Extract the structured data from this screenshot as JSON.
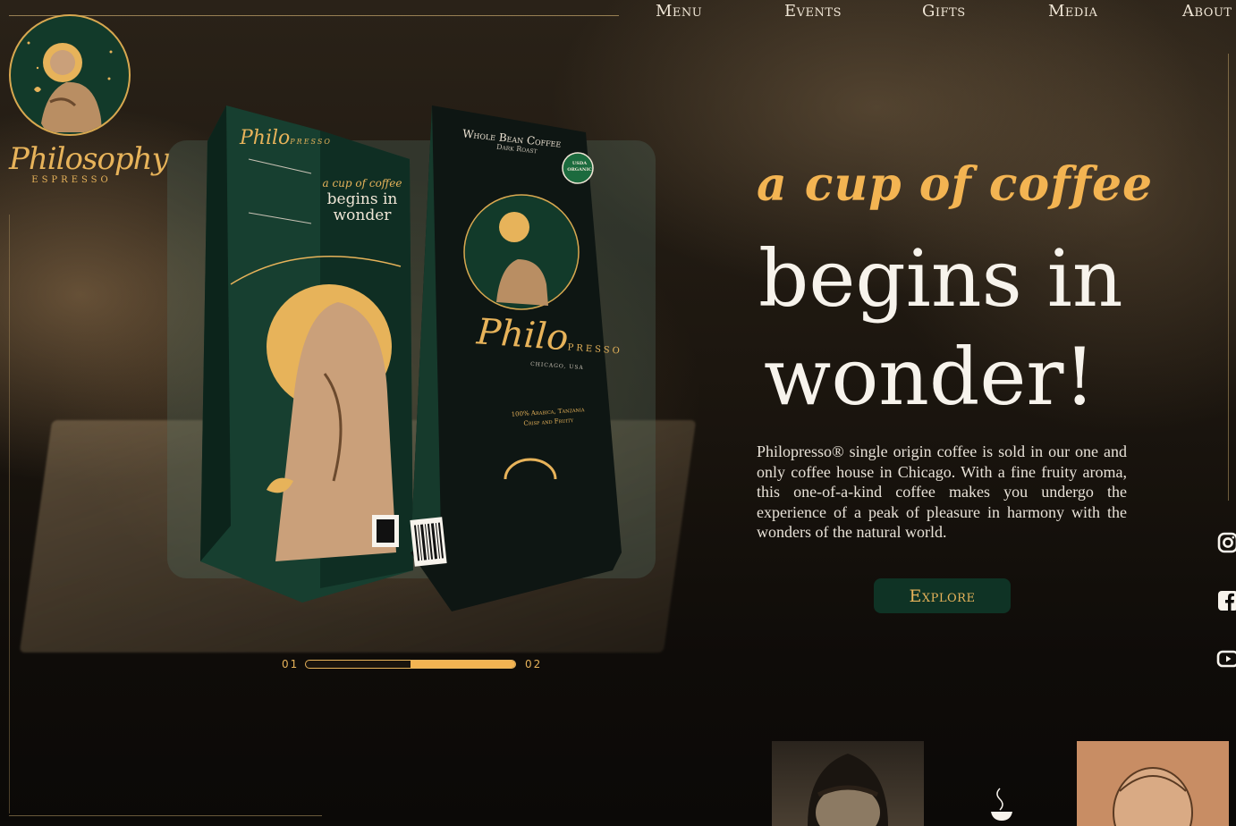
{
  "brand": {
    "name": "Philosophy",
    "subtitle": "ESPRESSO"
  },
  "nav": {
    "items": [
      "Menu",
      "Events",
      "Gifts",
      "Media",
      "About"
    ]
  },
  "product": {
    "bag_left_brand": "Philo",
    "bag_left_brand_small": "PRESSO",
    "bag_left_tagline": [
      "a cup of coffee",
      "begins in",
      "wonder"
    ],
    "bag_right_header": "Whole Bean Coffee",
    "bag_right_subheader": "Dark Roast",
    "bag_right_badge": "USDA ORGANIC",
    "bag_right_brand": "Philo",
    "bag_right_brand_small": "PRESSO",
    "bag_right_city": "CHICAGO, USA",
    "bag_right_origin": [
      "100% Arabica, Tanzania",
      "Crisp and Fruity"
    ]
  },
  "hero": {
    "script": "a cup of coffee",
    "line1": "begins in",
    "line2": "wonder!",
    "body": "Philopresso® single origin coffee is sold in our one and only coffee house in Chicago. With a fine fruity aroma, this one-of-a-kind coffee makes you undergo the experience of a peak of pleasure in harmony with the wonders of the natural world.",
    "cta": "Explore"
  },
  "slider": {
    "start": "01",
    "end": "02",
    "progress": 0.5
  },
  "social": {
    "icons": [
      "instagram-icon",
      "facebook-icon",
      "youtube-icon"
    ]
  },
  "colors": {
    "gold": "#f3b452",
    "green": "#123a2a",
    "button": "#0f3325",
    "cream": "#f7f3ec"
  }
}
